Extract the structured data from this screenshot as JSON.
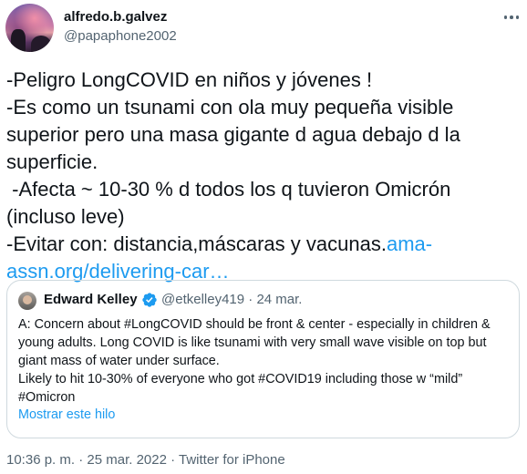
{
  "author": {
    "display_name": "alfredo.b.galvez",
    "handle": "@papaphone2002"
  },
  "tweet": {
    "text": "-Peligro LongCOVID en niños y jóvenes !\n-Es como un tsunami con ola muy pequeña visible superior pero una masa gigante d agua debajo d la superficie.\n -Afecta ~ 10-30 % d todos los q tuvieron Omicrón (incluso leve)\n-Evitar con: distancia,máscaras y vacunas.",
    "link_text": "ama-assn.org/delivering-car…"
  },
  "quote": {
    "display_name": "Edward Kelley",
    "handle_date": "@etkelley419 · 24 mar.",
    "text": "A: Concern about #LongCOVID should be front & center - especially in children & young adults. Long COVID is like tsunami with very small wave visible on top but giant mass of water under surface.\nLikely to hit 10-30% of everyone who got #COVID19 including those w “mild” #Omicron",
    "show_thread": "Mostrar este hilo"
  },
  "meta": {
    "timestamp_source": "10:36 p. m. · 25 mar. 2022 · Twitter for iPhone"
  },
  "colors": {
    "link": "#1d9bf0",
    "secondary_text": "#536471",
    "border": "#cfd9de"
  },
  "icons": {
    "more": "more-horizontal-icon",
    "verified": "verified-badge-icon"
  }
}
